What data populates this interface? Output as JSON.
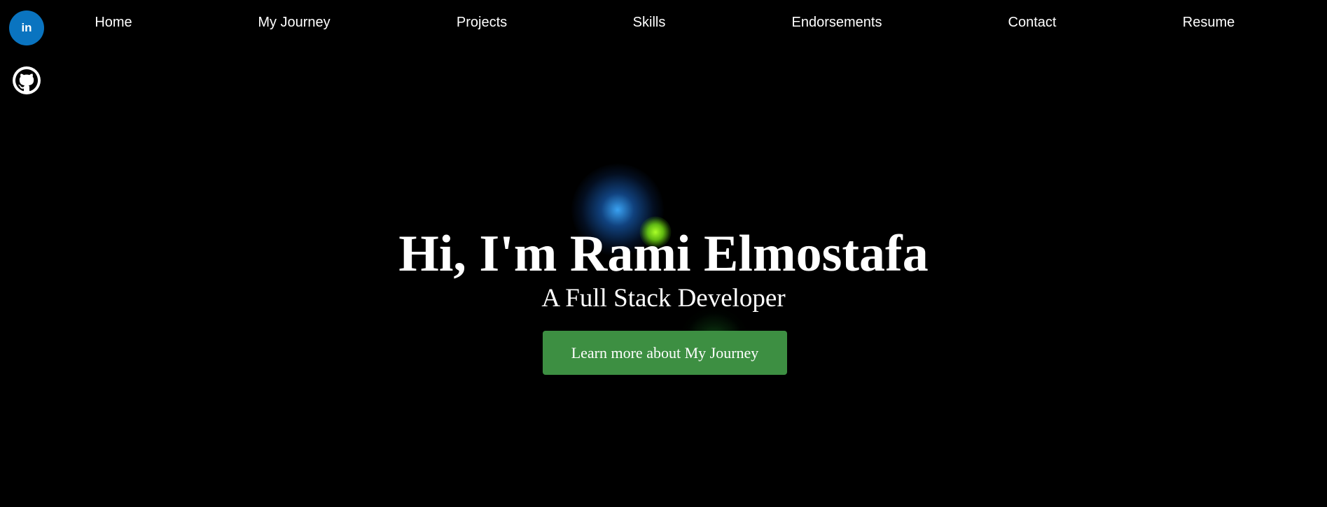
{
  "social": {
    "linkedin_label": "in",
    "linkedin_icon": "linkedin-icon",
    "github_icon": "github-icon",
    "linkedin_color": "#0a74c0"
  },
  "nav": {
    "items": [
      {
        "label": "Home"
      },
      {
        "label": "My Journey"
      },
      {
        "label": "Projects"
      },
      {
        "label": "Skills"
      },
      {
        "label": "Endorsements"
      },
      {
        "label": "Contact"
      },
      {
        "label": "Resume"
      }
    ]
  },
  "hero": {
    "title": "Hi, I'm Rami Elmostafa",
    "subtitle": "A Full Stack Developer",
    "cta_label": "Learn more about My Journey"
  },
  "colors": {
    "background": "#000000",
    "text": "#ffffff",
    "cta": "#3d8f42"
  }
}
